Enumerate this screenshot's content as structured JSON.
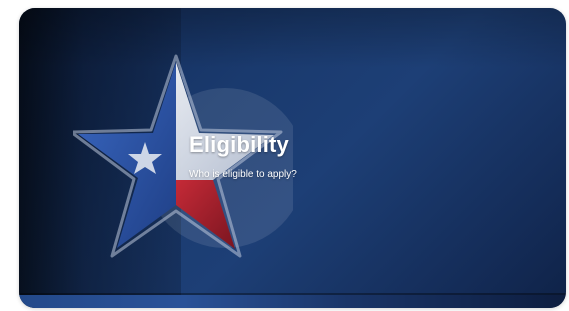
{
  "card": {
    "title": "Eligibility",
    "subtitle": "Who is eligible to apply?",
    "icon": "texas-star-seal-icon",
    "colors": {
      "background": "#1a3a6e",
      "star_blue": "#2d56a8",
      "star_red": "#b0242f",
      "star_white": "#e6e9ef",
      "text": "#ffffff"
    }
  }
}
